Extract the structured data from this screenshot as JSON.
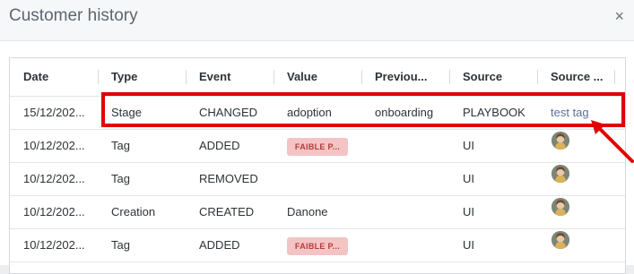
{
  "dialog": {
    "title": "Customer history",
    "close_glyph": "×"
  },
  "columns": [
    "Date",
    "Type",
    "Event",
    "Value",
    "Previou...",
    "Source",
    "Source ..."
  ],
  "rows": [
    {
      "date": "15/12/202...",
      "type": "Stage",
      "event": "CHANGED",
      "value": "adoption",
      "previous": "onboarding",
      "source": "PLAYBOOK",
      "source_by": "test tag"
    },
    {
      "date": "10/12/202...",
      "type": "Tag",
      "event": "ADDED",
      "value": "FAIBLE P...",
      "previous": "",
      "source": "UI",
      "source_by": "avatar"
    },
    {
      "date": "10/12/202...",
      "type": "Tag",
      "event": "REMOVED",
      "value": "",
      "previous": "",
      "source": "UI",
      "source_by": "avatar"
    },
    {
      "date": "10/12/202...",
      "type": "Creation",
      "event": "CREATED",
      "value": "Danone",
      "previous": "",
      "source": "UI",
      "source_by": "avatar"
    },
    {
      "date": "10/12/202...",
      "type": "Tag",
      "event": "ADDED",
      "value": "FAIBLE P...",
      "previous": "",
      "source": "UI",
      "source_by": "avatar"
    }
  ],
  "colors": {
    "highlight": "#e00000",
    "tag_bg": "#f4c4c4",
    "tag_text": "#b43c3c",
    "link": "#5b6fa0"
  }
}
